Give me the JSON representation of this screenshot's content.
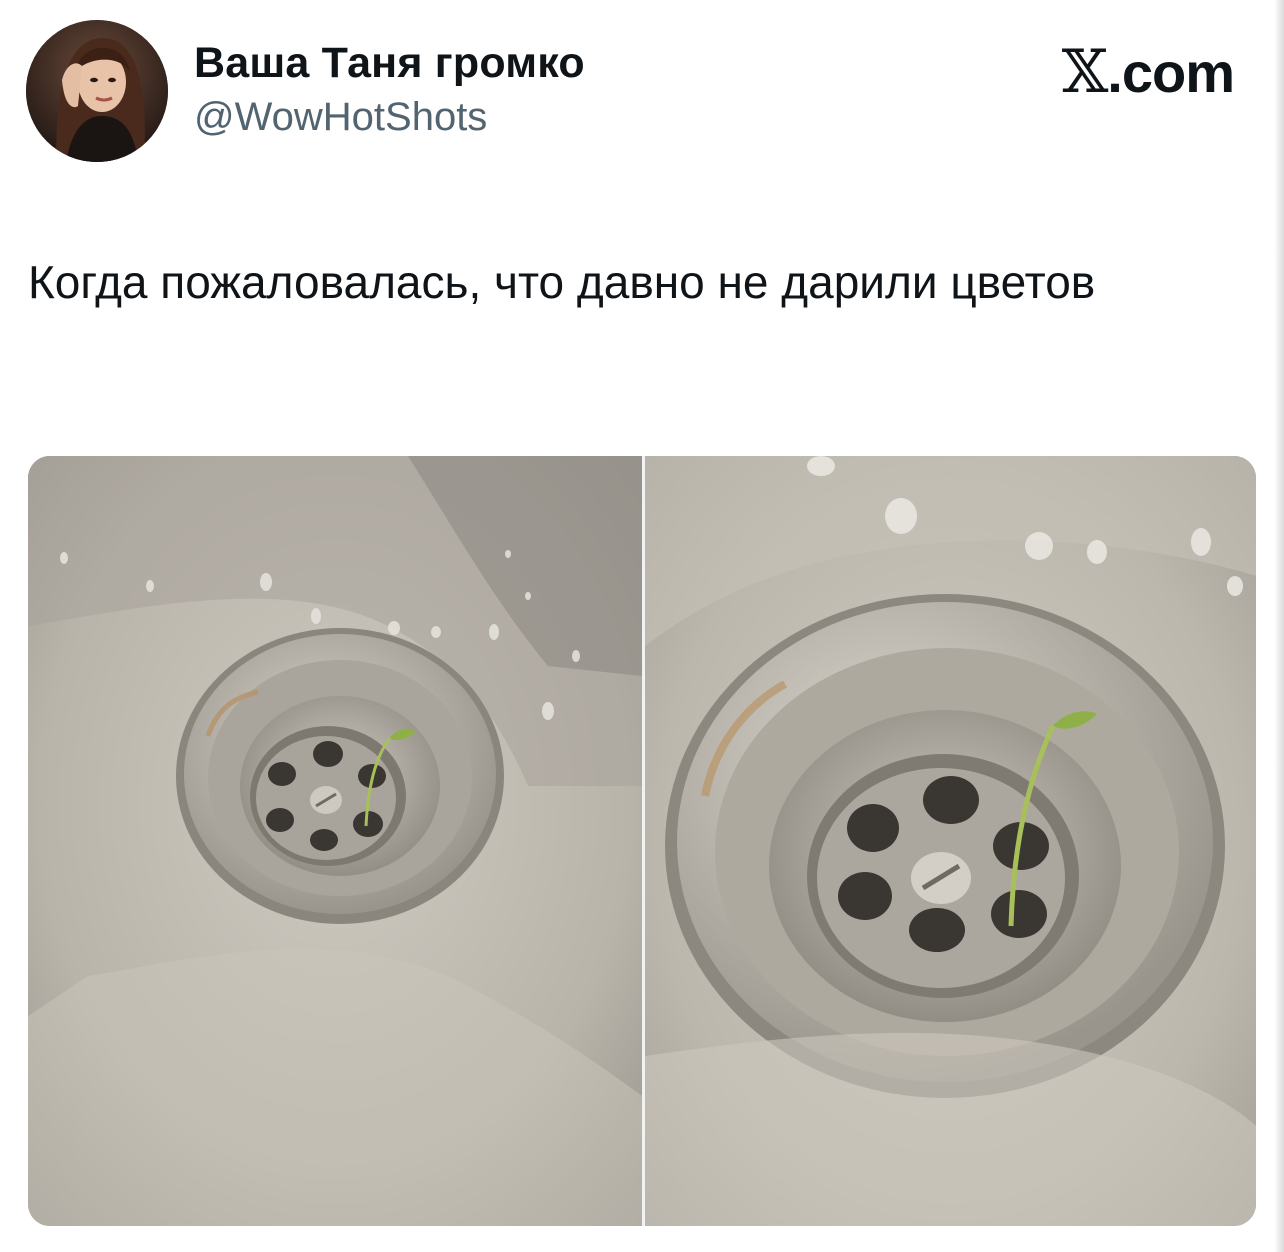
{
  "tweet": {
    "author": {
      "display_name": "Ваша Таня громко",
      "handle": "@WowHotShots"
    },
    "brand": {
      "icon": "x-logo-icon",
      "domain_suffix": ".com"
    },
    "text": "Когда пожаловалась, что давно не дарили цветов"
  },
  "media": {
    "images": [
      {
        "id": "left-panel",
        "subject": "sink-drain-with-sprout"
      },
      {
        "id": "right-panel",
        "subject": "sink-drain-with-sprout-closeup"
      }
    ]
  },
  "colors": {
    "text_primary": "#0f1419",
    "text_secondary": "#536471",
    "background": "#ffffff",
    "steel": "#bdb8ae",
    "sprout": "#9bbf4a"
  }
}
